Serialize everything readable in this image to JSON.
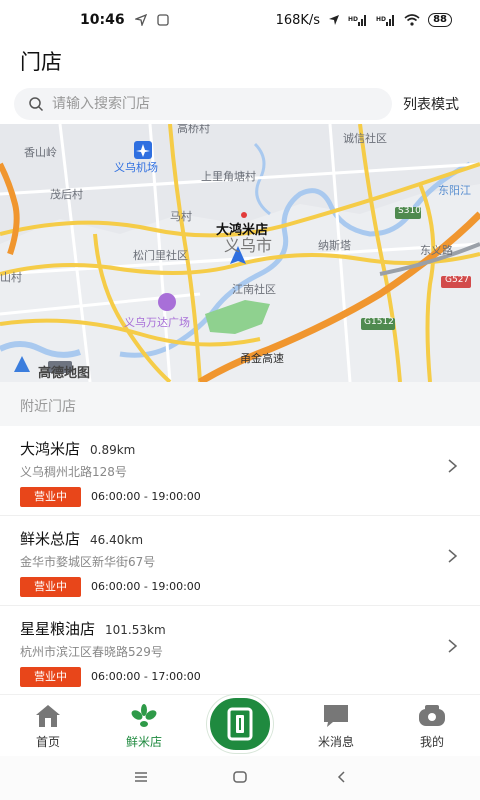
{
  "status": {
    "time": "10:46",
    "speed": "168K/s",
    "signal1": "HD",
    "signal2": "HD",
    "battery": "88"
  },
  "page": {
    "title": "门店",
    "search_placeholder": "请输入搜索门店",
    "list_mode": "列表模式"
  },
  "map": {
    "labels": {
      "xiangshanling": "香山岭",
      "gaoqiaocun": "高桥村",
      "chengxin": "诚信社区",
      "airport": "义乌机场",
      "shangliangjiao": "上里角塘村",
      "donyangjiang": "东阳江",
      "maohou": "茂后村",
      "macun": "马村",
      "store_pin": "大鸿米店",
      "city": "义乌市",
      "nasite": "纳斯塔",
      "songmen": "松门里社区",
      "jiangnan": "江南社区",
      "dongyi": "东义路",
      "shancun": "山村",
      "wanda": "义乌万达广场",
      "yongjin": "甬金高速",
      "logo": "高德地图",
      "s310": "S310",
      "g527": "G527",
      "g1512": "G1512",
      "x": "X"
    }
  },
  "nearby": {
    "title": "附近门店"
  },
  "stores": [
    {
      "name": "大鸿米店",
      "distance": "0.89km",
      "address": "义乌稠州北路128号",
      "status": "营业中",
      "hours": "06:00:00 - 19:00:00"
    },
    {
      "name": "鲜米总店",
      "distance": "46.40km",
      "address": "金华市婺城区新华街67号",
      "status": "营业中",
      "hours": "06:00:00 - 19:00:00"
    },
    {
      "name": "星星粮油店",
      "distance": "101.53km",
      "address": "杭州市滨江区春晓路529号",
      "status": "营业中",
      "hours": "06:00:00 - 17:00:00"
    }
  ],
  "tabs": [
    {
      "label": "首页",
      "icon": "home-icon"
    },
    {
      "label": "鲜米店",
      "icon": "leaf-icon"
    },
    {
      "label": "",
      "icon": "scan-icon"
    },
    {
      "label": "米消息",
      "icon": "message-icon"
    },
    {
      "label": "我的",
      "icon": "profile-icon"
    }
  ],
  "colors": {
    "accent": "#1f8a3f",
    "badge": "#e8461a"
  }
}
